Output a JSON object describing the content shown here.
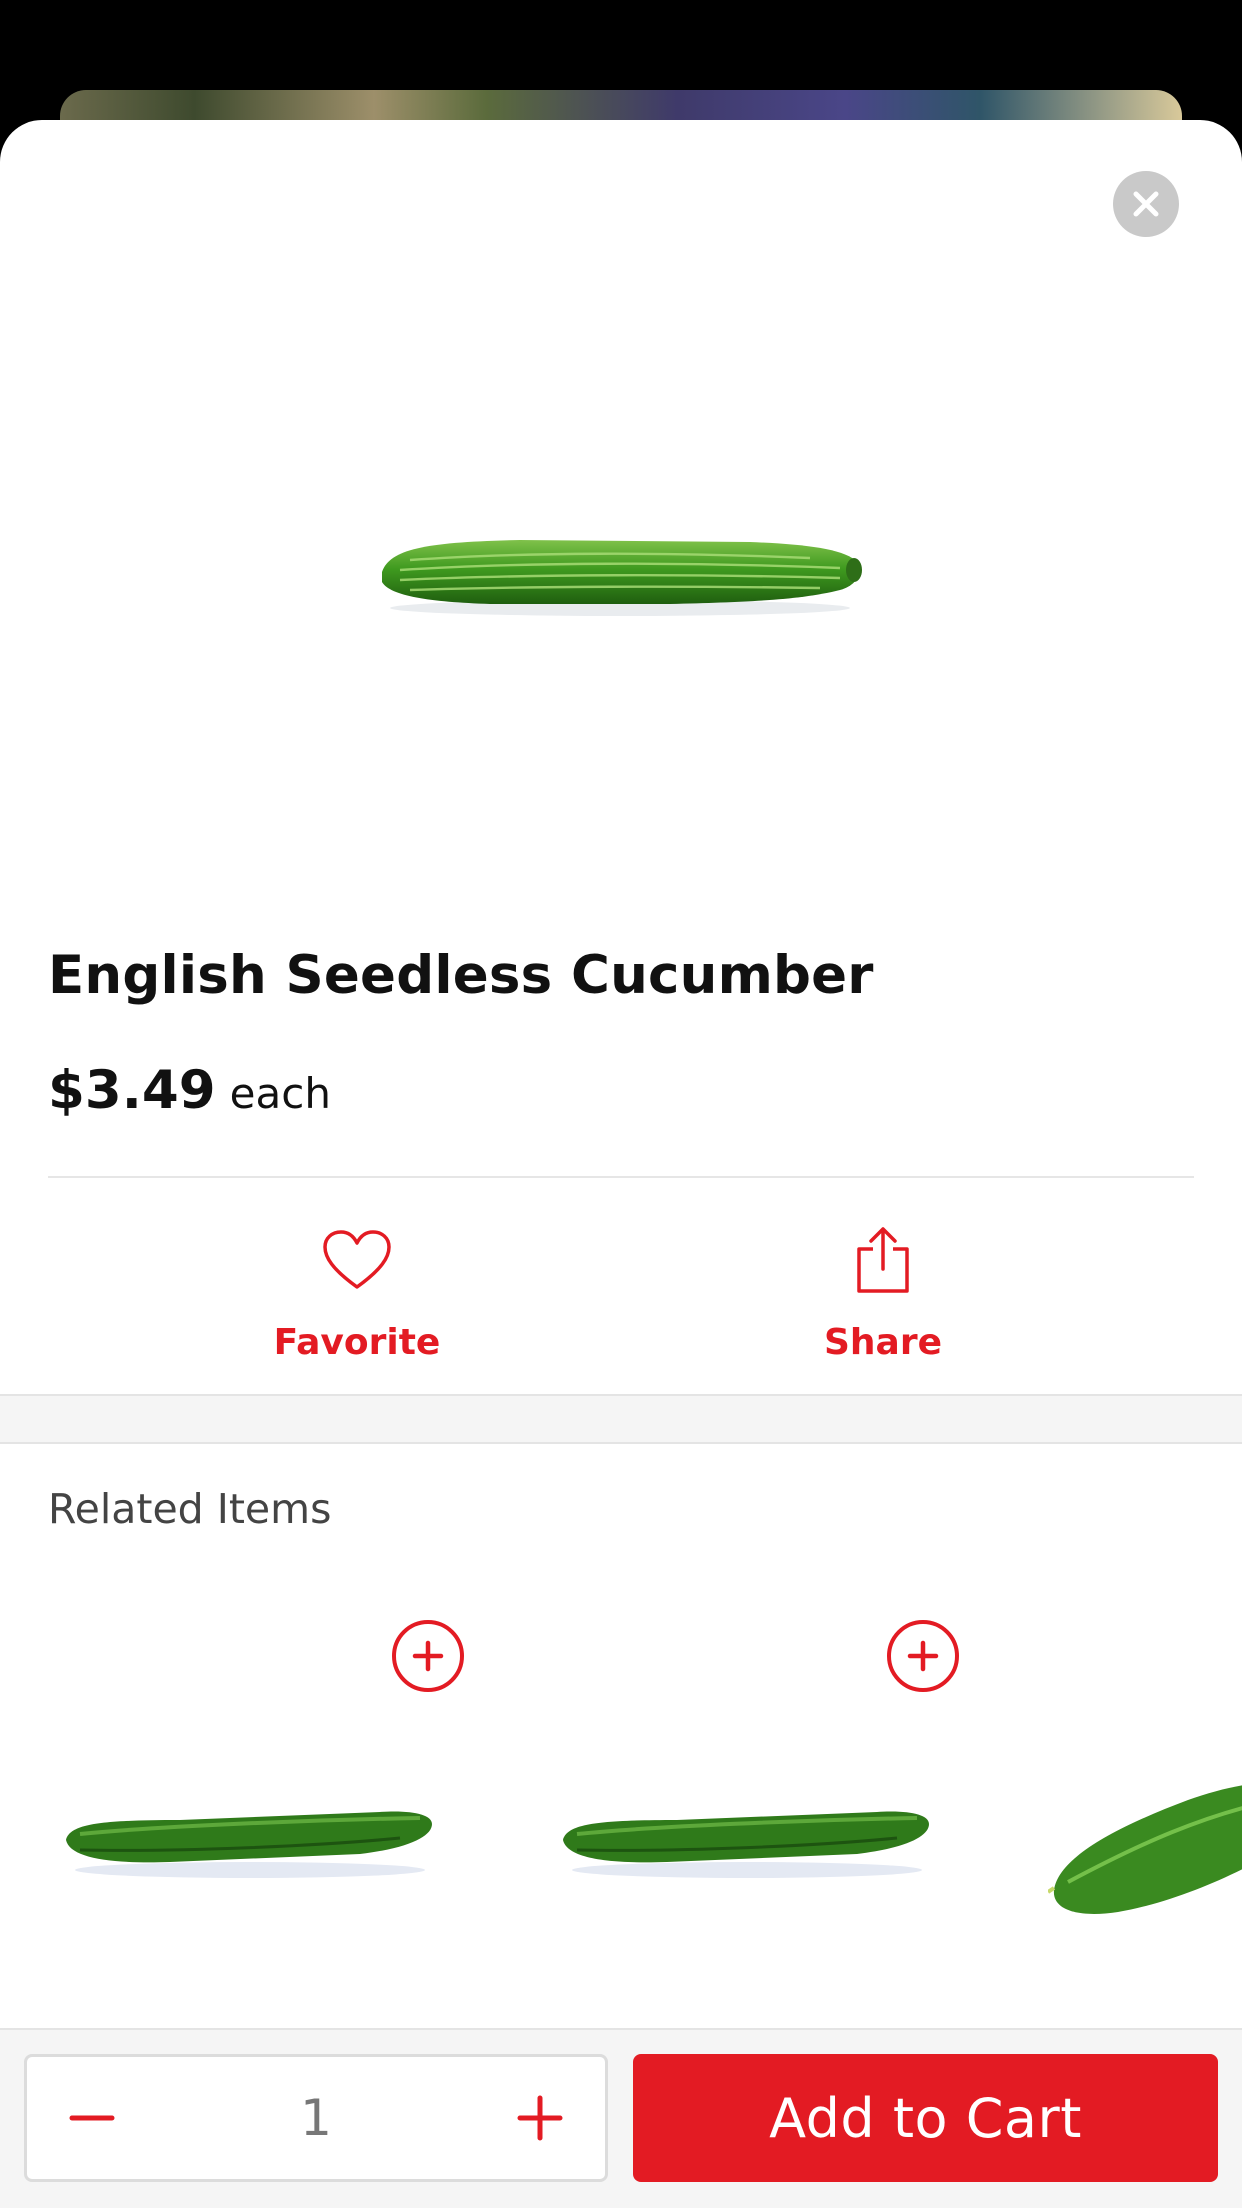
{
  "product": {
    "name": "English Seedless Cucumber",
    "price": "$3.49",
    "unit": "each",
    "image_icon": "cucumber-image"
  },
  "actions": {
    "favorite_label": "Favorite",
    "share_label": "Share"
  },
  "related": {
    "title": "Related Items",
    "items": [
      {
        "image_icon": "cucumber-image",
        "add_icon": "plus-circle-icon"
      },
      {
        "image_icon": "cucumber-image",
        "add_icon": "plus-circle-icon"
      },
      {
        "image_icon": "cucumber-image"
      }
    ]
  },
  "cart": {
    "quantity": "1",
    "add_label": "Add to Cart"
  },
  "colors": {
    "accent": "#e31b23",
    "close_bg": "#c9c9c9",
    "band_bg": "#f5f5f5"
  }
}
